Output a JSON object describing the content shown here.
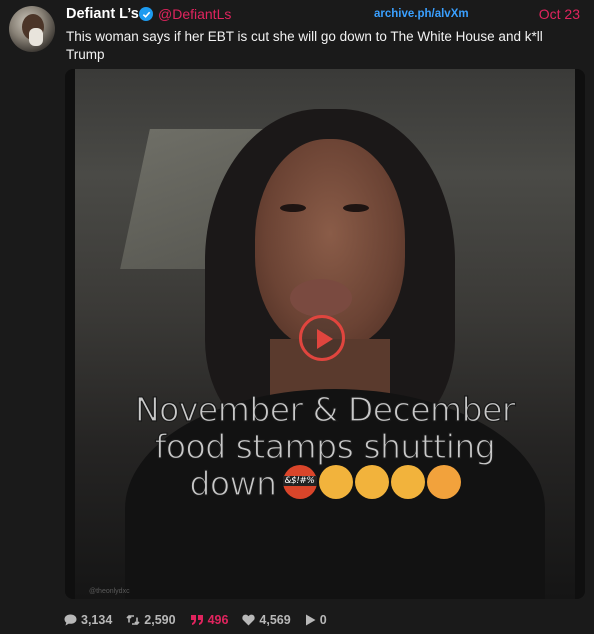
{
  "post": {
    "display_name": "Defiant L’s",
    "handle": "@DefiantLs",
    "archive_link": "archive.ph/alvXm",
    "date": "Oct 23",
    "text": "This woman says if her EBT is cut she will go down to The White House and k*ll Trump"
  },
  "media": {
    "caption_lines": [
      "November & December",
      "food stamps shutting"
    ],
    "caption_last_word": "down",
    "emoji_censor_text": "&$!#%",
    "watermark": "@theonlydxc"
  },
  "stats": {
    "replies": "3,134",
    "reposts": "2,590",
    "quotes": "496",
    "likes": "4,569",
    "views": "0"
  },
  "colors": {
    "accent": "#e0245e",
    "link": "#3aa0ff",
    "verified": "#1d9bf0",
    "play_ring": "#e0453e",
    "background": "#1a1a1a"
  }
}
